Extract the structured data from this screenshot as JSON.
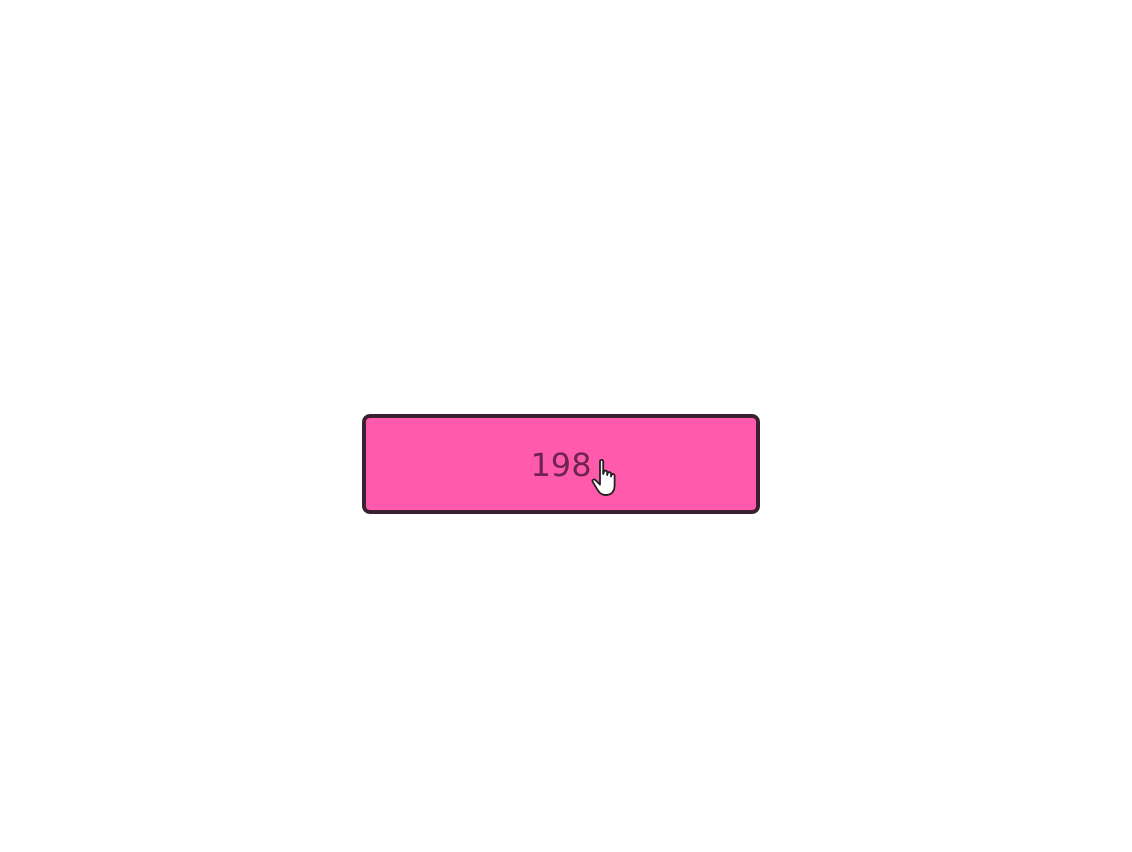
{
  "button": {
    "label": "198"
  }
}
